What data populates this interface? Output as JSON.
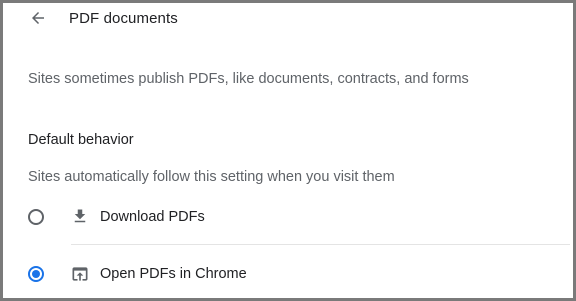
{
  "header": {
    "back_icon": "arrow-back-icon",
    "title": "PDF documents"
  },
  "description": "Sites sometimes publish PDFs, like documents, contracts, and forms",
  "default_behavior": {
    "heading": "Default behavior",
    "subtitle": "Sites automatically follow this setting when you visit them",
    "options": [
      {
        "label": "Download PDFs",
        "icon": "download-icon",
        "selected": false
      },
      {
        "label": "Open PDFs in Chrome",
        "icon": "open-in-browser-icon",
        "selected": true
      }
    ]
  },
  "colors": {
    "accent": "#1a73e8",
    "text_primary": "#202124",
    "text_secondary": "#5f6368",
    "divider": "#e4e4e4",
    "frame": "#7a7a7a"
  }
}
